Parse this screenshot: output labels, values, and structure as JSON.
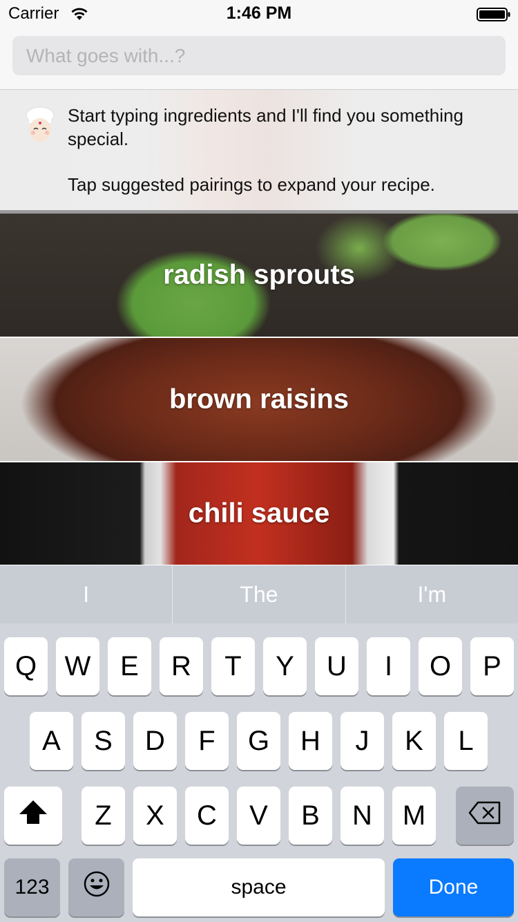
{
  "status_bar": {
    "carrier": "Carrier",
    "time": "1:46 PM"
  },
  "search": {
    "placeholder": "What goes with...?",
    "value": ""
  },
  "message": {
    "line1": "Start typing ingredients and I'll find you something special.",
    "line2": "Tap suggested pairings to expand your recipe."
  },
  "ingredients": [
    {
      "label": "radish sprouts"
    },
    {
      "label": "brown raisins"
    },
    {
      "label": "chili sauce"
    }
  ],
  "keyboard": {
    "suggestions": [
      "I",
      "The",
      "I'm"
    ],
    "row1": [
      "Q",
      "W",
      "E",
      "R",
      "T",
      "Y",
      "U",
      "I",
      "O",
      "P"
    ],
    "row2": [
      "A",
      "S",
      "D",
      "F",
      "G",
      "H",
      "J",
      "K",
      "L"
    ],
    "row3": [
      "Z",
      "X",
      "C",
      "V",
      "B",
      "N",
      "M"
    ],
    "numbers_label": "123",
    "space_label": "space",
    "done_label": "Done",
    "shift_icon": "shift-arrow-icon",
    "delete_icon": "backspace-icon",
    "emoji_icon": "emoji-icon",
    "done_color": "#0a7aff"
  }
}
